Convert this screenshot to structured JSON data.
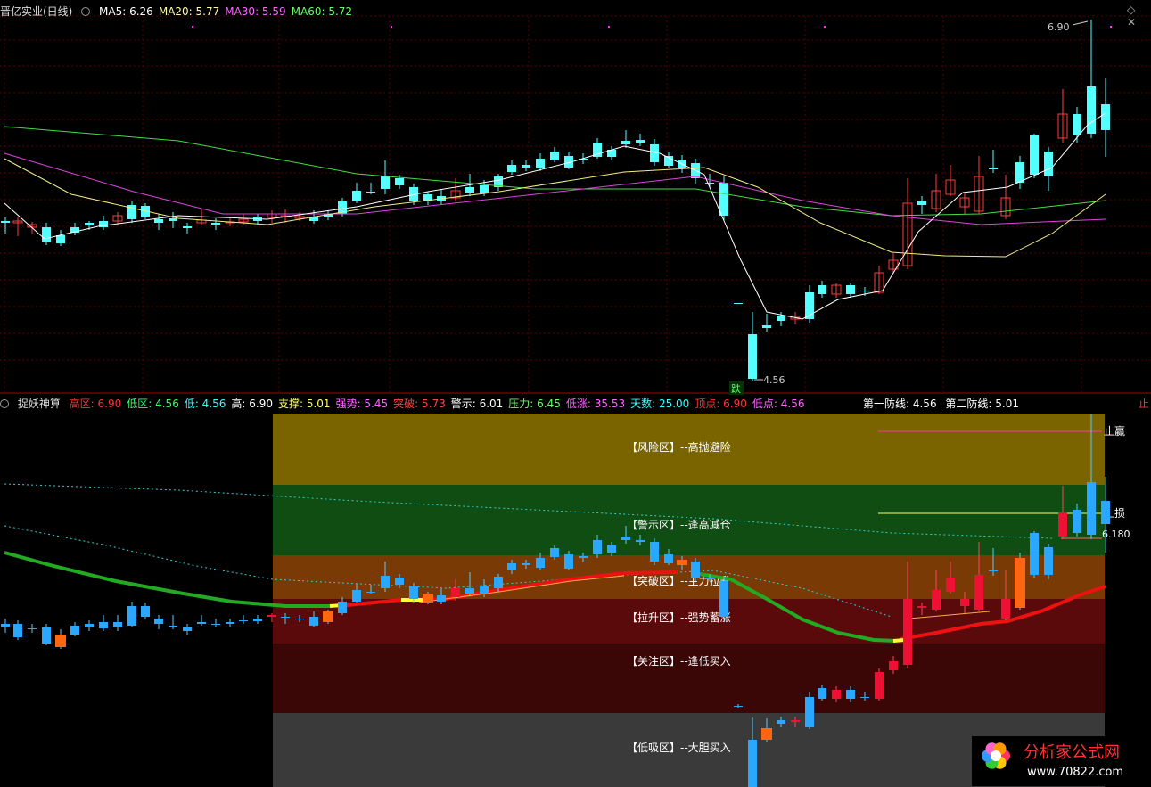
{
  "top_panel": {
    "title": "晋亿实业(日线)",
    "indicators": [
      {
        "label": "MA5: 6.26",
        "color": "#ffffff"
      },
      {
        "label": "MA20: 5.77",
        "color": "#ffffa0"
      },
      {
        "label": "MA30: 5.59",
        "color": "#ff66ff"
      },
      {
        "label": "MA60: 5.72",
        "color": "#66ff66"
      }
    ],
    "high_label": "6.90",
    "low_label": "4.56",
    "fall_tag": "跌"
  },
  "bottom_panel": {
    "title": "捉妖神算",
    "indicators": [
      {
        "label": "高区: 6.90",
        "color": "#ff3333"
      },
      {
        "label": "低区: 4.56",
        "color": "#33ff66"
      },
      {
        "label": "低: 4.56",
        "color": "#33ffff"
      },
      {
        "label": "高: 6.90",
        "color": "#ffffff"
      },
      {
        "label": "支撑: 5.01",
        "color": "#ffff66"
      },
      {
        "label": "强势: 5.45",
        "color": "#ff66ff"
      },
      {
        "label": "突破: 5.73",
        "color": "#ff4444"
      },
      {
        "label": "警示: 6.01",
        "color": "#ffffff"
      },
      {
        "label": "压力: 6.45",
        "color": "#66ff66"
      },
      {
        "label": "低涨: 35.53",
        "color": "#ff66ff"
      },
      {
        "label": "天数: 25.00",
        "color": "#33ffff"
      },
      {
        "label": "顶点: 6.90",
        "color": "#ff3333"
      },
      {
        "label": "低点: 4.56",
        "color": "#ff66ff"
      }
    ],
    "right_labels": [
      "第一防线: 4.56",
      "第二防线: 5.01"
    ],
    "zones": [
      {
        "label": "【风险区】--高抛避险",
        "color": "#7a6400"
      },
      {
        "label": "【警示区】--逢高减仓",
        "color": "#0f4d12"
      },
      {
        "label": "【突破区】--主力拉升",
        "color": "#7a3a06"
      },
      {
        "label": "【拉升区】--强势蓄涨",
        "color": "#5a0a0a"
      },
      {
        "label": "【关注区】--逢低买入",
        "color": "#3a0606"
      },
      {
        "label": "【低吸区】--大胆买入",
        "color": "#3a3a3a"
      }
    ],
    "take_profit": "止赢",
    "stop_loss": "止损",
    "fib_label": "6.180"
  },
  "watermark": {
    "text": "分析家公式网",
    "url": "www.70822.com"
  },
  "icons": [
    "chevron-icon",
    "diamond-icon",
    "close-icon"
  ]
}
